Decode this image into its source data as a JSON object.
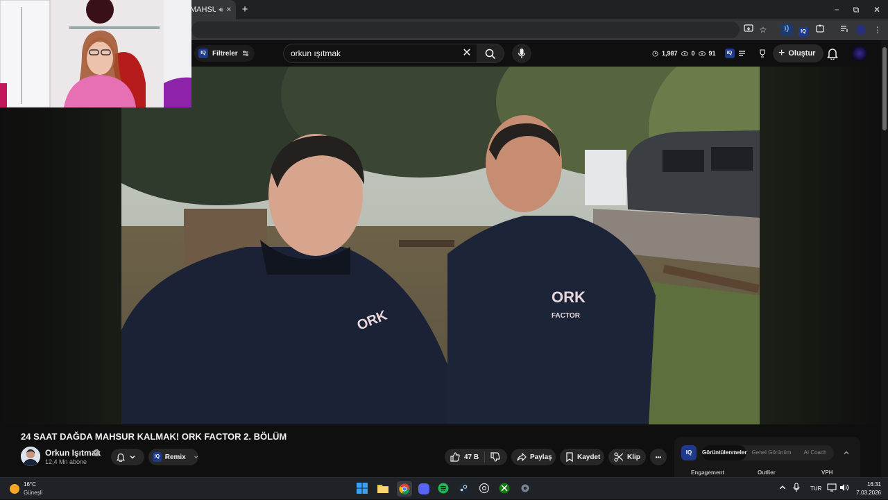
{
  "browser": {
    "tab_title": "MAHSUR",
    "new_tab": "+",
    "window_controls": {
      "minimize": "−",
      "restore": "⧉",
      "close": "✕"
    }
  },
  "masthead": {
    "filters_label": "Filtreler",
    "iq_label": "IQ",
    "search_value": "orkun ışıtmak",
    "clear": "✕",
    "stats": {
      "views": "1,987",
      "comments": "0",
      "watching": "91"
    },
    "create_label": "Oluştur"
  },
  "video": {
    "title": "24 SAAT DAĞDA MAHSUR KALMAK! ORK FACTOR 2. BÖLÜM",
    "channel_name": "Orkun Işıtmak",
    "subscribers": "12,4 Mn abone",
    "shirt_text_1": "ORK",
    "shirt_text_2": "FACTOR",
    "remix_label": "Remix",
    "likes": "47 B",
    "share_label": "Paylaş",
    "save_label": "Kaydet",
    "clip_label": "Klip",
    "more_label": "•••"
  },
  "iq_panel": {
    "logo": "IQ",
    "tabs": [
      "Görüntülenmeler",
      "Genel Görünüm",
      "AI Coach"
    ],
    "active_tab": "Görüntülenmeler",
    "columns": [
      "Engagement",
      "Outlier",
      "VPH"
    ]
  },
  "taskbar": {
    "weather_temp": "16°C",
    "weather_cond": "Güneşli",
    "language": "TUR",
    "time": "16:31",
    "date": "7.03.2026"
  },
  "colors": {
    "background": "#0f0f0f",
    "pill": "#272727",
    "iq_blue": "#1e3a8a",
    "taskbar": "#1f2226"
  }
}
